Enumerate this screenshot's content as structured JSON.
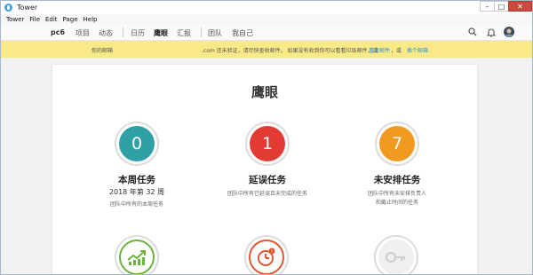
{
  "window": {
    "title": "Tower",
    "controls": [
      "–",
      "□",
      "✕"
    ]
  },
  "menu": [
    "Tower",
    "File",
    "Edit",
    "Page",
    "Help"
  ],
  "nav": {
    "team": "pc6",
    "items": [
      "项目",
      "动态",
      "日历",
      "鹰眼",
      "汇报",
      "团队",
      "我自己"
    ],
    "active": "鹰眼"
  },
  "banner": {
    "left": "你的邮箱",
    "middle": ".com 还未验证，请尽快查收邮件。 如果没有收到你可以看看垃圾邮件，或",
    "link1": "重发邮件",
    "or": "，或",
    "link2": "换个邮箱"
  },
  "page": {
    "title": "鹰眼"
  },
  "stats": [
    {
      "value": "0",
      "label": "本周任务",
      "sub": "2018 年第 32 周",
      "desc": "团队中所有的本周任务",
      "color": "#2ea0a6"
    },
    {
      "value": "1",
      "label": "延误任务",
      "sub": "",
      "desc": "团队中所有已延误且未完成的任务",
      "color": "#e23b33"
    },
    {
      "value": "7",
      "label": "未安排任务",
      "sub": "",
      "desc": "团队中所有未安排负责人\n和截止时间的任务",
      "color": "#f29a1f"
    }
  ],
  "bottom_icons": [
    {
      "name": "trend-chart-icon",
      "color": "#6ab43e"
    },
    {
      "name": "clock-icon",
      "color": "#e0582f"
    },
    {
      "name": "key-icon",
      "color": "#eeeeee"
    }
  ]
}
